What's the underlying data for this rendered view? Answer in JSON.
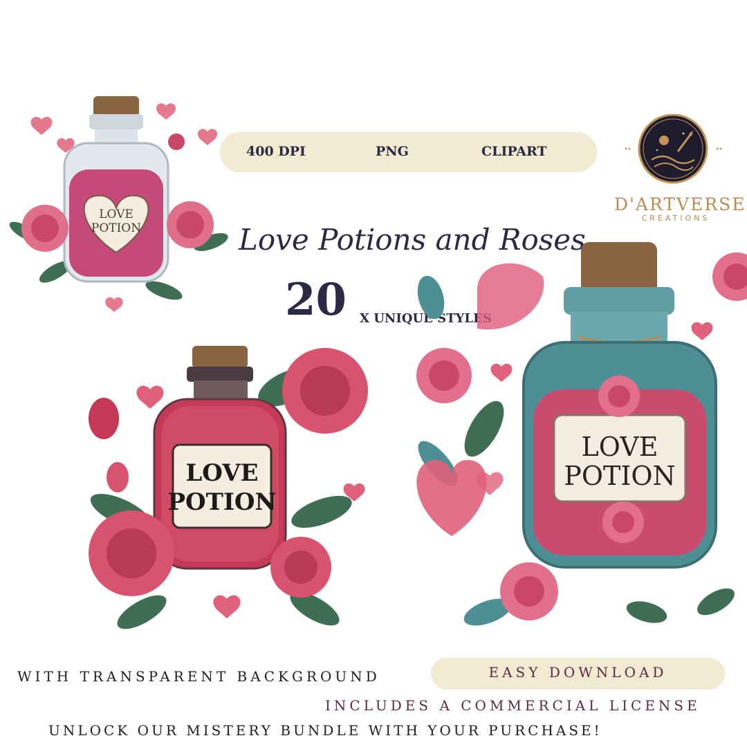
{
  "badges": {
    "dpi": "400 DPI",
    "format": "PNG",
    "type": "CLIPART"
  },
  "brand": {
    "name": "D'ARTVERSE",
    "sub": "CREATIONS"
  },
  "title": "Love Potions and Roses",
  "count": {
    "number": "20",
    "label": "X UNIQUE STYLES"
  },
  "bottle_labels": {
    "small": [
      "LOVE",
      "POTION"
    ],
    "center": [
      "LOVE",
      "POTION"
    ],
    "large": [
      "LOVE",
      "POTION"
    ]
  },
  "footer": {
    "transparent": "WITH TRANSPARENT BACKGROUND",
    "download": "EASY DOWNLOAD",
    "license": "INCLUDES A COMMERCIAL LICENSE",
    "bundle": "UNLOCK OUR MISTERY BUNDLE WITH YOUR PURCHASE!"
  },
  "colors": {
    "pill": "#f3ead2",
    "navy": "#2b2a44",
    "plum": "#5a2a44",
    "gold": "#b98a52",
    "rose": "#e0617a",
    "leaf": "#3f6e55",
    "teal": "#4e8f95"
  }
}
